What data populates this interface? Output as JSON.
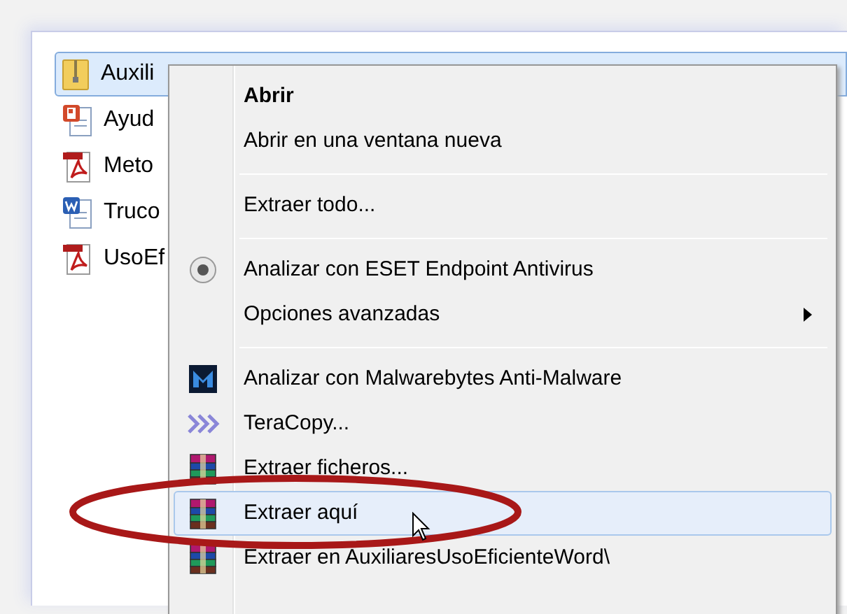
{
  "files": [
    {
      "name": "Auxili",
      "kind": "archive",
      "selected": true
    },
    {
      "name": "Ayud",
      "kind": "presentation",
      "selected": false
    },
    {
      "name": "Meto",
      "kind": "pdf",
      "selected": false
    },
    {
      "name": "Truco",
      "kind": "document",
      "selected": false
    },
    {
      "name": "UsoEf",
      "kind": "pdf",
      "selected": false
    }
  ],
  "context_menu": {
    "items": [
      {
        "kind": "command",
        "label": "Abrir",
        "default": true,
        "selected": false
      },
      {
        "kind": "command",
        "label": "Abrir en una ventana nueva",
        "default": false,
        "selected": false
      },
      {
        "kind": "separator"
      },
      {
        "kind": "command",
        "label": "Extraer todo...",
        "default": false,
        "selected": false
      },
      {
        "kind": "separator"
      },
      {
        "kind": "antivirus",
        "label": "Analizar con ESET Endpoint Antivirus",
        "default": false,
        "selected": false
      },
      {
        "kind": "submenu",
        "label": "Opciones avanzadas",
        "default": false,
        "selected": false
      },
      {
        "kind": "separator"
      },
      {
        "kind": "malware-scan",
        "label": "Analizar con Malwarebytes Anti-Malware",
        "default": false,
        "selected": false
      },
      {
        "kind": "copy",
        "label": "TeraCopy...",
        "default": false,
        "selected": false
      },
      {
        "kind": "archive",
        "label": "Extraer ficheros...",
        "default": false,
        "selected": false
      },
      {
        "kind": "archive",
        "label": "Extraer aquí",
        "default": false,
        "selected": true
      },
      {
        "kind": "archive",
        "label": "Extraer en AuxiliaresUsoEficienteWord\\",
        "default": false,
        "selected": false
      }
    ]
  }
}
